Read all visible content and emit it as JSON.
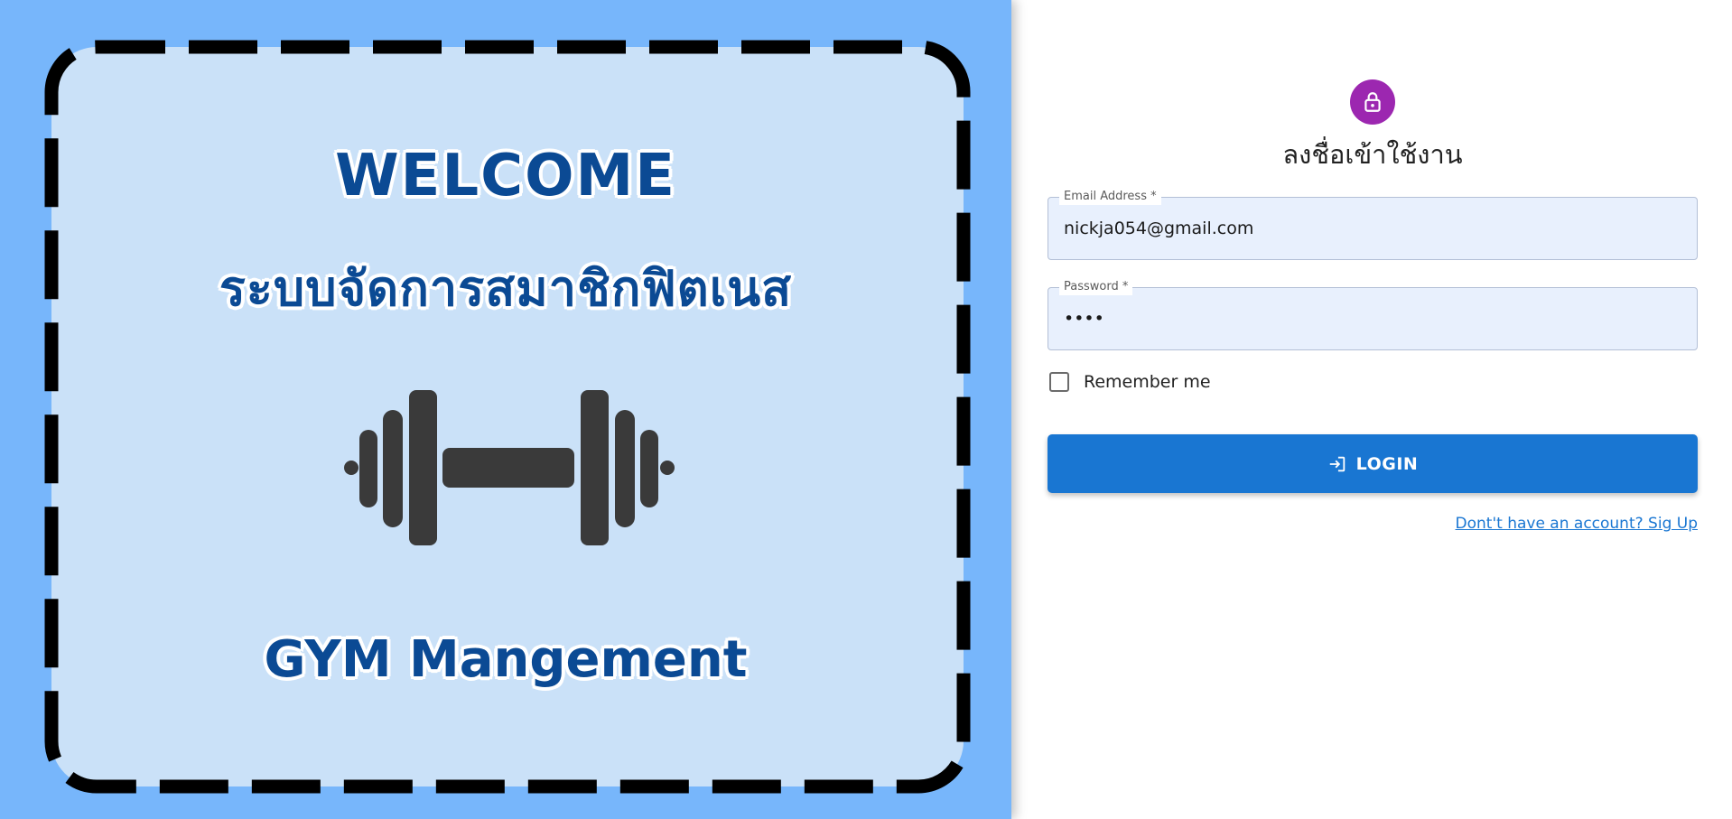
{
  "hero": {
    "welcome": "WELCOME",
    "system_name": "ระบบจัดการสมาชิกฟิตเนส",
    "subtitle": "GYM Mangement",
    "image_icon": "dumbbell-icon"
  },
  "form": {
    "avatar_icon": "lock-icon",
    "heading": "ลงชื่อเข้าใช้งาน",
    "email": {
      "label": "Email Address *",
      "value": "nickja054@gmail.com"
    },
    "password": {
      "label": "Password *",
      "value": "••••"
    },
    "remember_label": "Remember me",
    "remember_checked": false,
    "login_label": "LOGIN",
    "login_icon": "login-icon",
    "signup_link": "Dont't have an account? Sig Up"
  },
  "colors": {
    "hero_background": "#77b6fb",
    "card_background": "#cae1f8",
    "title_color": "#0b4a94",
    "avatar": "#9c27b0",
    "primary": "#1976d2",
    "field_background": "#e8f0fd"
  }
}
